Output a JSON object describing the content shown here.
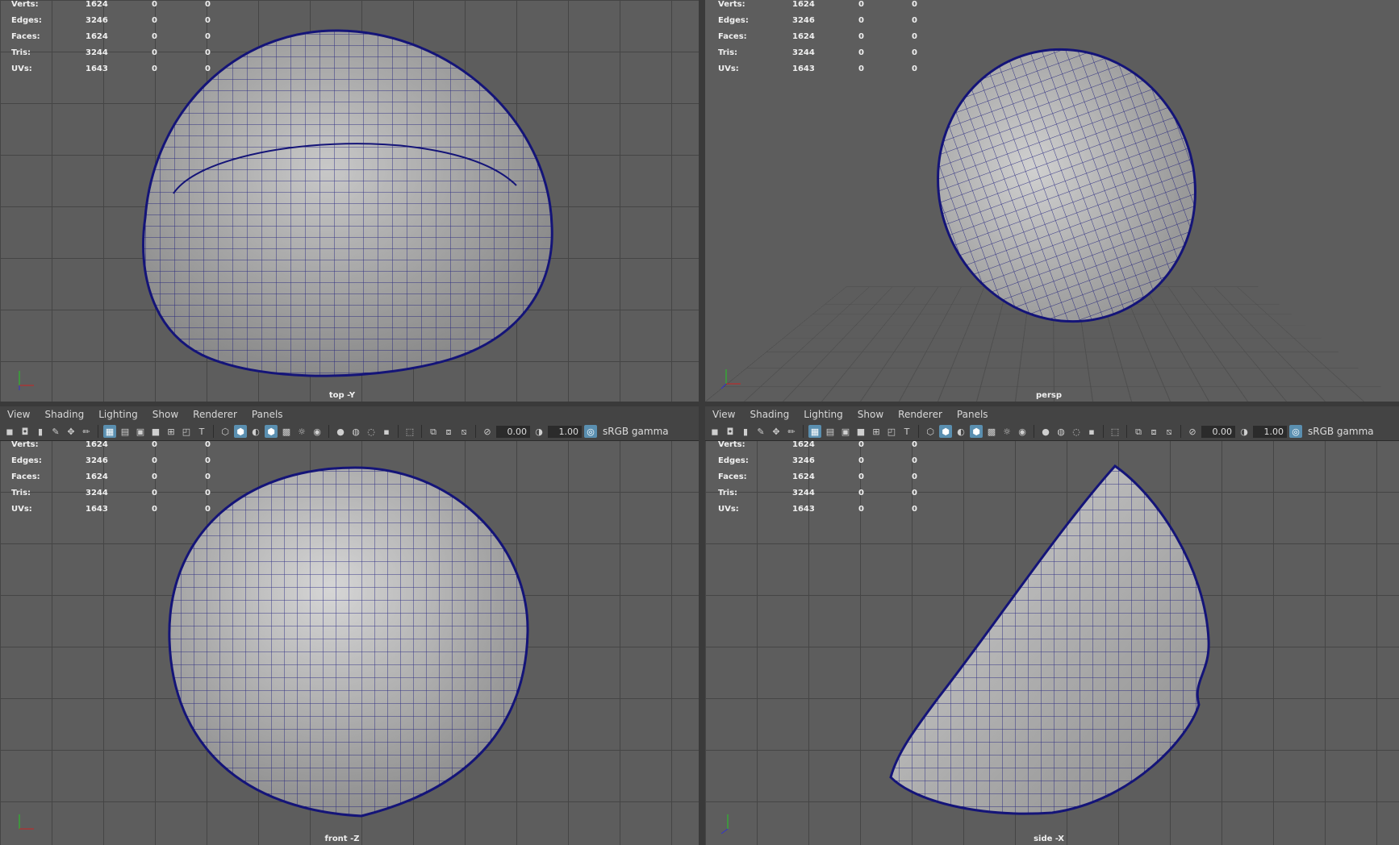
{
  "viewports": [
    {
      "id": "top",
      "camera": "top -Y"
    },
    {
      "id": "persp",
      "camera": "persp"
    },
    {
      "id": "front",
      "camera": "front -Z"
    },
    {
      "id": "side",
      "camera": "side -X"
    }
  ],
  "menu": [
    "View",
    "Shading",
    "Lighting",
    "Show",
    "Renderer",
    "Panels"
  ],
  "toolbar": {
    "exposure": "0.00",
    "gamma": "1.00",
    "colorspace": "sRGB gamma"
  },
  "hud": {
    "rows": [
      {
        "label": "Verts:",
        "total": "1624",
        "a": "0",
        "b": "0"
      },
      {
        "label": "Edges:",
        "total": "3246",
        "a": "0",
        "b": "0"
      },
      {
        "label": "Faces:",
        "total": "1624",
        "a": "0",
        "b": "0"
      },
      {
        "label": "Tris:",
        "total": "3244",
        "a": "0",
        "b": "0"
      },
      {
        "label": "UVs:",
        "total": "1643",
        "a": "0",
        "b": "0"
      }
    ]
  },
  "colors": {
    "wire": "#141478",
    "surface": "#aaaaaa",
    "grid": "#454545",
    "accent": "#5a8fb0"
  }
}
